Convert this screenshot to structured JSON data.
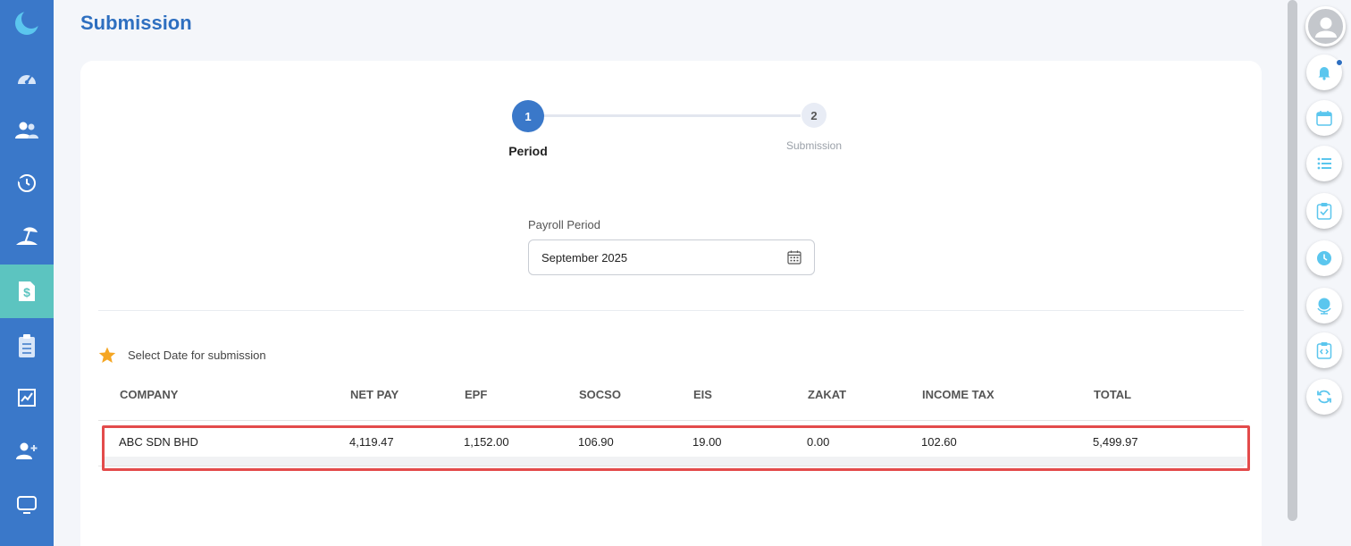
{
  "page": {
    "title": "Submission"
  },
  "sidebar": {
    "items": [
      {
        "icon": "dashboard-gauge-icon"
      },
      {
        "icon": "users-icon"
      },
      {
        "icon": "history-icon"
      },
      {
        "icon": "beach-leave-icon"
      },
      {
        "icon": "payroll-dollar-icon",
        "active": true
      },
      {
        "icon": "clipboard-icon"
      },
      {
        "icon": "chart-icon"
      },
      {
        "icon": "add-user-icon"
      },
      {
        "icon": "monitor-icon"
      }
    ]
  },
  "stepper": {
    "steps": [
      {
        "number": "1",
        "label": "Period",
        "active": true
      },
      {
        "number": "2",
        "label": "Submission",
        "active": false
      }
    ]
  },
  "payroll_period": {
    "label": "Payroll Period",
    "value": "September 2025"
  },
  "select_date": {
    "text": "Select Date for submission"
  },
  "table": {
    "headers": [
      "COMPANY",
      "NET PAY",
      "EPF",
      "SOCSO",
      "EIS",
      "ZAKAT",
      "INCOME TAX",
      "TOTAL"
    ],
    "rows": [
      [
        "ABC SDN BHD",
        "4,119.47",
        "1,152.00",
        "106.90",
        "19.00",
        "0.00",
        "102.60",
        "5,499.97"
      ]
    ]
  },
  "right_rail": {
    "items": [
      "avatar-icon",
      "bell-icon",
      "calendar-icon",
      "list-icon",
      "clipboard-check-icon",
      "clock-icon",
      "globe-icon",
      "code-file-icon",
      "refresh-icon"
    ]
  },
  "colors": {
    "primary": "#3a78c9",
    "active_item": "#5cc4c0",
    "highlight": "#e34b4b",
    "accent_icon": "#5bc6ee"
  }
}
